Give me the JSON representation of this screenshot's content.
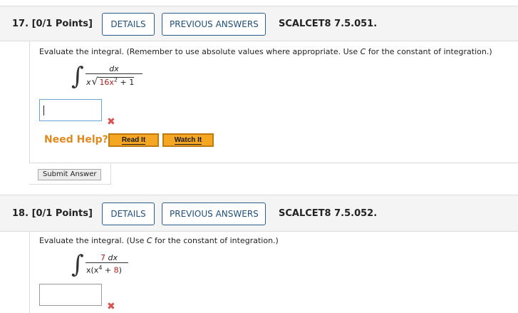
{
  "q17": {
    "number": "17.",
    "points": "[0/1 Points]",
    "details_label": "DETAILS",
    "previous_answers_label": "PREVIOUS ANSWERS",
    "code": "SCALCET8 7.5.051.",
    "prompt_a": "Evaluate the integral. (Remember to use absolute values where appropriate. Use ",
    "prompt_c": "C",
    "prompt_b": " for the constant of integration.)",
    "numerator": "dx",
    "denominator_x": "x",
    "radicand": "16x",
    "radicand_exp": "2",
    "radicand_tail": " + 1",
    "answer_value": "",
    "need_help": "Need Help?",
    "read_it": "Read It",
    "watch_it": "Watch It",
    "submit": "Submit Answer"
  },
  "q18": {
    "number": "18.",
    "points": "[0/1 Points]",
    "details_label": "DETAILS",
    "previous_answers_label": "PREVIOUS ANSWERS",
    "code": "SCALCET8 7.5.052.",
    "prompt_a": "Evaluate the integral. (Use ",
    "prompt_c": "C",
    "prompt_b": " for the constant of integration.)",
    "numerator_coef": "7",
    "numerator_var": " dx",
    "denominator_a": "x(x",
    "denominator_exp": "4",
    "denominator_b": " + ",
    "denominator_c": "8",
    "denominator_d": ")",
    "answer_value": ""
  },
  "colors": {
    "accent_blue": "#1f4f7a",
    "help_orange": "#e08a1e",
    "button_orange": "#f5a623",
    "wrong_red": "#d9534f"
  },
  "icons": {
    "wrong": "cross-icon"
  }
}
